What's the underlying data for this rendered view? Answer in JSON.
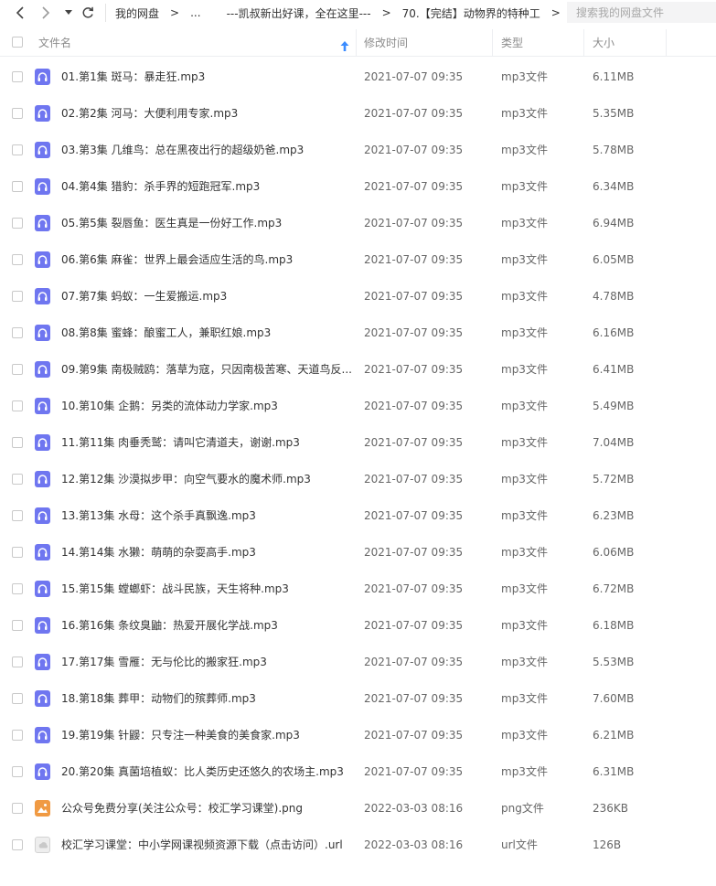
{
  "nav": {
    "back_icon": "chevron-left-icon",
    "forward_icon": "chevron-right-icon",
    "dropdown_icon": "caret-down-icon",
    "refresh_icon": "refresh-icon"
  },
  "breadcrumb": {
    "items": [
      "我的网盘",
      "...",
      "---凯叔新出好课，全在这里---",
      "70.【完结】动物界的特种工"
    ],
    "separator": ">"
  },
  "search": {
    "placeholder": "搜索我的网盘文件"
  },
  "header": {
    "name": "文件名",
    "modified": "修改时间",
    "type": "类型",
    "size": "大小",
    "sort_icon": "arrow-up-icon"
  },
  "colors": {
    "mp3_icon": "#6f76f0",
    "png_icon": "#f09a43",
    "sort_arrow": "#3b8cff"
  },
  "files": [
    {
      "name": "01.第1集 斑马：暴走狂.mp3",
      "time": "2021-07-07 09:35",
      "type": "mp3文件",
      "size": "6.11MB",
      "icon": "mp3"
    },
    {
      "name": "02.第2集 河马：大便利用专家.mp3",
      "time": "2021-07-07 09:35",
      "type": "mp3文件",
      "size": "5.35MB",
      "icon": "mp3"
    },
    {
      "name": "03.第3集 几维鸟：总在黑夜出行的超级奶爸.mp3",
      "time": "2021-07-07 09:35",
      "type": "mp3文件",
      "size": "5.78MB",
      "icon": "mp3"
    },
    {
      "name": "04.第4集 猎豹：杀手界的短跑冠军.mp3",
      "time": "2021-07-07 09:35",
      "type": "mp3文件",
      "size": "6.34MB",
      "icon": "mp3"
    },
    {
      "name": "05.第5集 裂唇鱼：医生真是一份好工作.mp3",
      "time": "2021-07-07 09:35",
      "type": "mp3文件",
      "size": "6.94MB",
      "icon": "mp3"
    },
    {
      "name": "06.第6集 麻雀：世界上最会适应生活的鸟.mp3",
      "time": "2021-07-07 09:35",
      "type": "mp3文件",
      "size": "6.05MB",
      "icon": "mp3"
    },
    {
      "name": "07.第7集 蚂蚁：一生爱搬运.mp3",
      "time": "2021-07-07 09:35",
      "type": "mp3文件",
      "size": "4.78MB",
      "icon": "mp3"
    },
    {
      "name": "08.第8集 蜜蜂：酿蜜工人，兼职红娘.mp3",
      "time": "2021-07-07 09:35",
      "type": "mp3文件",
      "size": "6.16MB",
      "icon": "mp3"
    },
    {
      "name": "09.第9集 南极贼鸥：落草为寇，只因南极苦寒、天道鸟反...",
      "time": "2021-07-07 09:35",
      "type": "mp3文件",
      "size": "6.41MB",
      "icon": "mp3"
    },
    {
      "name": "10.第10集 企鹅：另类的流体动力学家.mp3",
      "time": "2021-07-07 09:35",
      "type": "mp3文件",
      "size": "5.49MB",
      "icon": "mp3"
    },
    {
      "name": "11.第11集 肉垂秃鹫：请叫它清道夫，谢谢.mp3",
      "time": "2021-07-07 09:35",
      "type": "mp3文件",
      "size": "7.04MB",
      "icon": "mp3"
    },
    {
      "name": "12.第12集 沙漠拟步甲：向空气要水的魔术师.mp3",
      "time": "2021-07-07 09:35",
      "type": "mp3文件",
      "size": "5.72MB",
      "icon": "mp3"
    },
    {
      "name": "13.第13集 水母：这个杀手真飘逸.mp3",
      "time": "2021-07-07 09:35",
      "type": "mp3文件",
      "size": "6.23MB",
      "icon": "mp3"
    },
    {
      "name": "14.第14集 水獭：萌萌的杂耍高手.mp3",
      "time": "2021-07-07 09:35",
      "type": "mp3文件",
      "size": "6.06MB",
      "icon": "mp3"
    },
    {
      "name": "15.第15集 螳螂虾：战斗民族，天生将种.mp3",
      "time": "2021-07-07 09:35",
      "type": "mp3文件",
      "size": "6.72MB",
      "icon": "mp3"
    },
    {
      "name": "16.第16集 条纹臭鼬：热爱开展化学战.mp3",
      "time": "2021-07-07 09:35",
      "type": "mp3文件",
      "size": "6.18MB",
      "icon": "mp3"
    },
    {
      "name": "17.第17集 雪雁：无与伦比的搬家狂.mp3",
      "time": "2021-07-07 09:35",
      "type": "mp3文件",
      "size": "5.53MB",
      "icon": "mp3"
    },
    {
      "name": "18.第18集 葬甲：动物们的殡葬师.mp3",
      "time": "2021-07-07 09:35",
      "type": "mp3文件",
      "size": "7.60MB",
      "icon": "mp3"
    },
    {
      "name": "19.第19集 针鼹：只专注一种美食的美食家.mp3",
      "time": "2021-07-07 09:35",
      "type": "mp3文件",
      "size": "6.21MB",
      "icon": "mp3"
    },
    {
      "name": "20.第20集 真菌培植蚁：比人类历史还悠久的农场主.mp3",
      "time": "2021-07-07 09:35",
      "type": "mp3文件",
      "size": "6.31MB",
      "icon": "mp3"
    },
    {
      "name": "公众号免费分享(关注公众号：校汇学习课堂).png",
      "time": "2022-03-03 08:16",
      "type": "png文件",
      "size": "236KB",
      "icon": "png"
    },
    {
      "name": "校汇学习课堂：中小学网课视频资源下载（点击访问）.url",
      "time": "2022-03-03 08:16",
      "type": "url文件",
      "size": "126B",
      "icon": "url"
    }
  ]
}
